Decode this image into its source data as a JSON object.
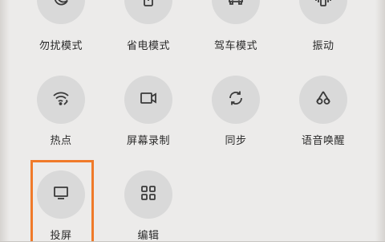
{
  "quick_settings": {
    "row1": [
      {
        "label": "勿扰模式",
        "icon": "moon-icon"
      },
      {
        "label": "省电模式",
        "icon": "battery-saver-icon"
      },
      {
        "label": "驾车模式",
        "icon": "car-icon"
      },
      {
        "label": "振动",
        "icon": "vibrate-icon"
      }
    ],
    "row2": [
      {
        "label": "热点",
        "icon": "hotspot-icon"
      },
      {
        "label": "屏幕录制",
        "icon": "screen-record-icon"
      },
      {
        "label": "同步",
        "icon": "sync-icon"
      },
      {
        "label": "语音唤醒",
        "icon": "voice-wake-icon"
      }
    ],
    "row3": [
      {
        "label": "投屏",
        "icon": "cast-screen-icon",
        "highlighted": true
      },
      {
        "label": "编辑",
        "icon": "edit-grid-icon"
      }
    ]
  },
  "colors": {
    "highlight": "#f07a2a",
    "tile_bg": "#d9d9d9",
    "icon": "#3a3a3a"
  }
}
